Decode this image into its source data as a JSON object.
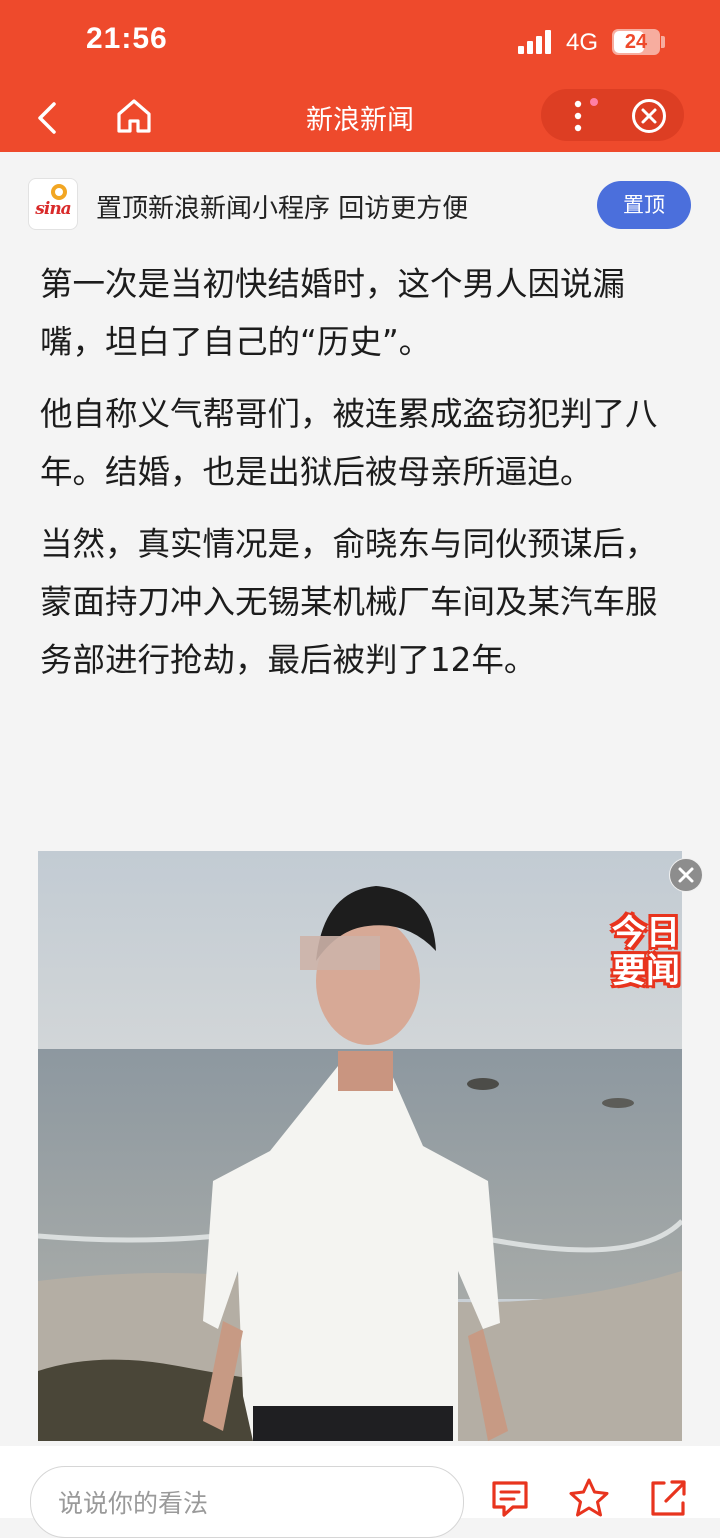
{
  "status_bar": {
    "time": "21:56",
    "network": "4G",
    "battery": "24"
  },
  "nav": {
    "title": "新浪新闻",
    "back_icon": "chevron-left-icon",
    "home_icon": "home-icon",
    "more_icon": "more-vertical-icon",
    "close_icon": "close-circle-icon"
  },
  "pin_banner": {
    "logo_text": "sina",
    "text": "置顶新浪新闻小程序 回访更方便",
    "button_label": "置顶"
  },
  "article": {
    "paragraphs": [
      "第一次是当初快结婚时，这个男人因说漏嘴，坦白了自己的“历史”。",
      "他自称义气帮哥们，被连累成盗窃犯判了八年。结婚，也是出狱后被母亲所逼迫。",
      "当然，真实情况是，俞晓东与同伙预谋后，蒙面持刀冲入无锡某机械厂车间及某汽车服务部进行抢劫，最后被判了12年。"
    ],
    "photo": {
      "badge_line1": "今日",
      "badge_line2": "要闻",
      "close_icon": "close-icon"
    }
  },
  "comment_bar": {
    "placeholder": "说说你的看法",
    "icons": [
      "comment-icon",
      "star-icon",
      "share-icon"
    ]
  },
  "colors": {
    "brand_red": "#ee4a2c",
    "pin_blue": "#4b6fdc"
  }
}
